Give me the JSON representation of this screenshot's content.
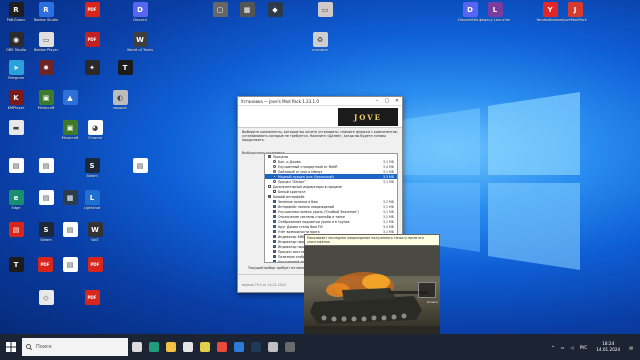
{
  "desktop": {
    "icons": [
      {
        "label": "Роб.Блокс",
        "color": "#1f1f1f",
        "glyph": "R"
      },
      {
        "label": "Roblox Studio",
        "color": "#2b6fe0",
        "glyph": "R"
      },
      {
        "label": "",
        "color": "#d9261c",
        "glyph": "PDF"
      },
      {
        "label": "Discord",
        "color": "#5865f2",
        "glyph": "D"
      },
      {
        "label": "",
        "color": "#666666",
        "glyph": "▢"
      },
      {
        "label": "",
        "color": "#555555",
        "glyph": "▦"
      },
      {
        "label": "",
        "color": "#2d3a4a",
        "glyph": "◆"
      },
      {
        "label": "",
        "color": "#d0c9c9",
        "glyph": "▭"
      },
      {
        "label": "DiscordSetup",
        "color": "#5865f2",
        "glyph": "D"
      },
      {
        "label": "Legacy Launcher",
        "color": "#7a3c9e",
        "glyph": "L"
      },
      {
        "label": "YandexBrowser",
        "color": "#e42626",
        "glyph": "Y"
      },
      {
        "label": "JoveModPack",
        "color": "#d43b2e",
        "glyph": "J"
      },
      {
        "label": "OBS Studio",
        "color": "#2b2b2b",
        "glyph": "◉"
      },
      {
        "label": "Roblox Player",
        "color": "#e0e0e0",
        "glyph": "▭"
      },
      {
        "label": "",
        "color": "#c02121",
        "glyph": "PDF"
      },
      {
        "label": "World of Tanks",
        "color": "#3f3f3f",
        "glyph": "W"
      },
      {
        "label": "корзина",
        "color": "#cfcfcf",
        "glyph": "♻"
      },
      {
        "label": "Telegram",
        "color": "#2aa1da",
        "glyph": "➤"
      },
      {
        "label": "",
        "color": "#6c2424",
        "glyph": "✸"
      },
      {
        "label": "",
        "color": "#2a2a2a",
        "glyph": "✦"
      },
      {
        "label": "",
        "color": "#1c1c1c",
        "glyph": "T"
      },
      {
        "label": "KMPlayer",
        "color": "#7a1a1a",
        "glyph": "K"
      },
      {
        "label": "Minecraft",
        "color": "#3f7a2a",
        "glyph": "▣"
      },
      {
        "label": "",
        "color": "#2f6fd8",
        "glyph": "▲"
      },
      {
        "label": "мышка",
        "color": "#bcbcbc",
        "glyph": "◐"
      },
      {
        "label": "",
        "color": "#e8e8e8",
        "glyph": "▬"
      },
      {
        "label": "Minecraft",
        "color": "#3f7a2a",
        "glyph": "▣"
      },
      {
        "label": "Chrome",
        "color": "#ffffff",
        "glyph": "◕"
      },
      {
        "label": "",
        "color": "#ffffff",
        "glyph": "▤"
      },
      {
        "label": "",
        "color": "#ffffff",
        "glyph": "▤"
      },
      {
        "label": "Steam",
        "color": "#1b2838",
        "glyph": "S"
      },
      {
        "label": "",
        "color": "#ffffff",
        "glyph": "▤"
      },
      {
        "label": "Edge",
        "color": "#1a8f6f",
        "glyph": "e"
      },
      {
        "label": "",
        "color": "#ffffff",
        "glyph": "▤"
      },
      {
        "label": "",
        "color": "#2b3c4c",
        "glyph": "▦"
      },
      {
        "label": "Lightshot",
        "color": "#1f6fd0",
        "glyph": "L"
      },
      {
        "label": "",
        "color": "#d9261c",
        "glyph": "▤"
      },
      {
        "label": "Steam",
        "color": "#1b2838",
        "glyph": "S"
      },
      {
        "label": "",
        "color": "#ffffff",
        "glyph": "▤"
      },
      {
        "label": "WoT",
        "color": "#333333",
        "glyph": "W"
      },
      {
        "label": "",
        "color": "#1c1c1c",
        "glyph": "T"
      },
      {
        "label": "",
        "color": "#ffffff",
        "glyph": "▤"
      },
      {
        "label": "",
        "color": "#d9261c",
        "glyph": "PDF"
      },
      {
        "label": "",
        "color": "#d9261c",
        "glyph": "PDF"
      },
      {
        "label": "",
        "color": "#e9e9e9",
        "glyph": "◇"
      },
      {
        "label": "",
        "color": "#d9261c",
        "glyph": "PDF"
      }
    ]
  },
  "installer": {
    "title": "Установка — Jove's Mod Pack 1.23.1.0",
    "banner": "JOVE",
    "description": "Выберите компоненты, которые вы хотите установить; снимите флажки с компонентов, устанавливать которые не требуется. Нажмите «Далее», когда вы будете готовы продолжить.",
    "group_label": "Выборочная установка",
    "rows": [
      {
        "indent": 0,
        "kind": "cb",
        "checked": true,
        "name": "Прицелы",
        "size": ""
      },
      {
        "indent": 1,
        "kind": "rb",
        "checked": false,
        "name": "Бан- и Джова",
        "size": "3,1 МБ"
      },
      {
        "indent": 1,
        "kind": "rb",
        "checked": false,
        "name": "Улучшенный стандартный от MeltR",
        "size": "3,4 МБ"
      },
      {
        "indent": 1,
        "kind": "rb",
        "checked": false,
        "name": "Лайтовый от Jove и Иммуэ",
        "size": "3,1 МБ"
      },
      {
        "indent": 1,
        "kind": "rb",
        "checked": true,
        "name": "Модный прицел Jove (Уральский)",
        "size": "3,3 МБ",
        "selected": true
      },
      {
        "indent": 1,
        "kind": "rb",
        "checked": false,
        "name": "Прицел \"Zectan\"",
        "size": "3,1 МБ"
      },
      {
        "indent": 0,
        "kind": "cb",
        "checked": false,
        "name": "Дополнительные индикаторы в прицеле",
        "size": ""
      },
      {
        "indent": 1,
        "kind": "cb",
        "checked": false,
        "name": "Белый кристалл",
        "size": ""
      },
      {
        "indent": 0,
        "kind": "cb",
        "checked": true,
        "name": "Боевой интерфейс",
        "size": ""
      },
      {
        "indent": 1,
        "kind": "cb",
        "checked": true,
        "name": "Зелёные полоски в бою",
        "size": "3,2 МБ"
      },
      {
        "indent": 1,
        "kind": "cb",
        "checked": true,
        "name": "Интерфейс панель повреждений",
        "size": "3,1 МБ"
      },
      {
        "indent": 1,
        "kind": "cb",
        "checked": true,
        "name": "Улучшенная панель урона (\"Особый Значения\")",
        "size": "3,1 МБ"
      },
      {
        "indent": 1,
        "kind": "cb",
        "checked": true,
        "name": "Отключение системы стрельбы в танке",
        "size": "3,2 МБ"
      },
      {
        "indent": 1,
        "kind": "cb",
        "checked": true,
        "name": "Отображение подсветки уроне и в трупах",
        "size": "3,1 МБ"
      },
      {
        "indent": 1,
        "kind": "cb",
        "checked": true,
        "name": "Круг Джова стены бою FIS",
        "size": "3,4 МБ"
      },
      {
        "indent": 1,
        "kind": "cb",
        "checked": true,
        "name": "Учёт возможности врага",
        "size": "3,1 МБ"
      },
      {
        "indent": 1,
        "kind": "cb",
        "checked": true,
        "name": "Индикатор ХМБ",
        "size": "3,1 МБ"
      },
      {
        "indent": 1,
        "kind": "cb",
        "checked": true,
        "name": "Индикатор перезарядки и в бою",
        "size": "3,1 МБ"
      },
      {
        "indent": 1,
        "kind": "cb",
        "checked": true,
        "name": "Индикатор поражения поверхностей орудий",
        "size": "3,1 МБ"
      },
      {
        "indent": 1,
        "kind": "cb",
        "checked": true,
        "name": "Процесс восстановления в сезоне",
        "size": "3,1 МБ"
      },
      {
        "indent": 1,
        "kind": "cb",
        "checked": true,
        "name": "Полезные отображения по танку",
        "size": "3,1 МБ"
      },
      {
        "indent": 1,
        "kind": "cb",
        "checked": true,
        "name": "Улучшенный лог урона",
        "size": "3,1 МБ"
      },
      {
        "indent": 0,
        "kind": "cb",
        "checked": true,
        "name": "Ангар",
        "size": ""
      },
      {
        "indent": 1,
        "kind": "cb",
        "checked": true,
        "name": "XVM мини-карта",
        "size": ""
      },
      {
        "indent": 2,
        "kind": "rb",
        "checked": true,
        "name": "Стандартный стиль",
        "size": ""
      },
      {
        "indent": 2,
        "kind": "rb",
        "checked": false,
        "name": "Стиль (осенний)",
        "size": ""
      },
      {
        "indent": 1,
        "kind": "cb",
        "checked": false,
        "name": "Сессионная статистика",
        "size": ""
      }
    ],
    "space_label": "Текущий выбор требует не менее 38,3 МБ на диске.",
    "version": "версия 79.0 от 14.01.2024"
  },
  "tooltip": {
    "text": "Показывает последнее повреждение полученного танка и после его уничтожения"
  },
  "preview": {
    "topleft": "",
    "topright": "",
    "hud_label": "Колесо"
  },
  "taskbar": {
    "search_placeholder": "Поиск",
    "apps": [
      {
        "name": "task-view-icon",
        "color": "#dcdcdc"
      },
      {
        "name": "edge-icon",
        "color": "#1e9f7c"
      },
      {
        "name": "explorer-icon",
        "color": "#f3c146"
      },
      {
        "name": "store-icon",
        "color": "#e6e6e6"
      },
      {
        "name": "chrome-icon",
        "color": "#e3d04a"
      },
      {
        "name": "yandex-icon",
        "color": "#e84a3c"
      },
      {
        "name": "vpn-icon",
        "color": "#2d7bd9"
      },
      {
        "name": "steam-icon",
        "color": "#1f3a56"
      },
      {
        "name": "shortcut-icon",
        "color": "#c0c0c0"
      },
      {
        "name": "installer-icon",
        "color": "#6a6a6a"
      }
    ],
    "lang": "РУС",
    "time": "18:24",
    "date": "14.01.2024"
  }
}
